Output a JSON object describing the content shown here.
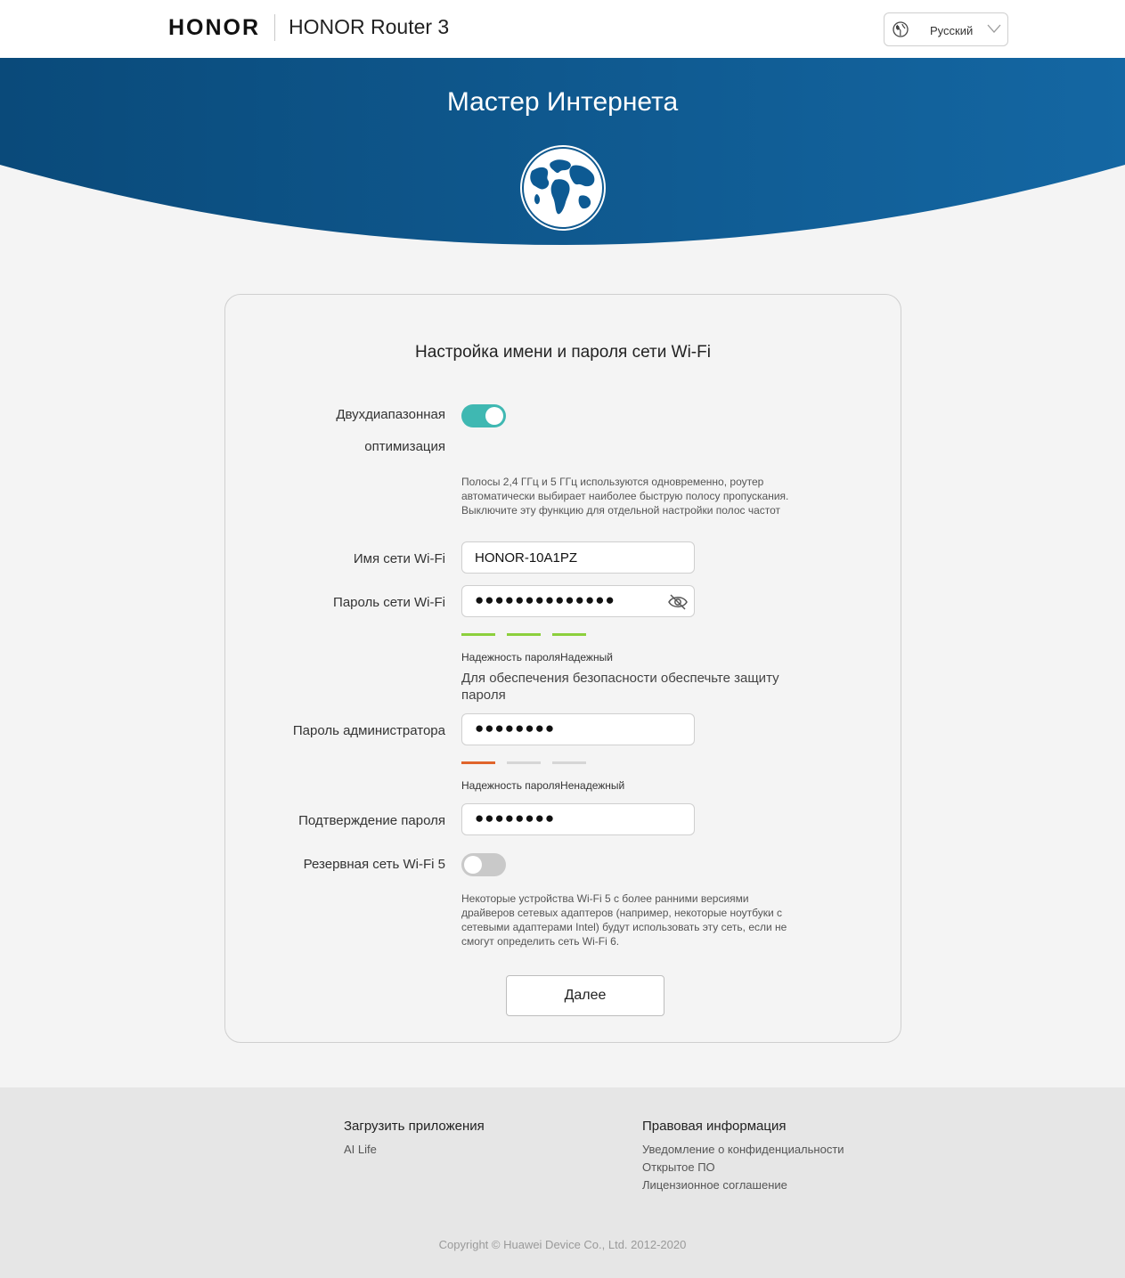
{
  "header": {
    "logo": "HONOR",
    "product": "HONOR Router 3",
    "language": "Русский"
  },
  "banner": {
    "title": "Мастер Интернета",
    "gradient_start": "#0a4a7a",
    "gradient_end": "#1467a3"
  },
  "card": {
    "title": "Настройка имени и пароля сети Wi-Fi",
    "dual_band": {
      "label_line1": "Двухдиапазонная",
      "label_line2": "оптимизация",
      "enabled": true,
      "hint": "Полосы 2,4 ГГц и 5 ГГц используются одновременно, роутер автоматически выбирает наиболее быструю полосу пропускания. Выключите эту функцию для отдельной настройки полос частот"
    },
    "wifi_name": {
      "label": "Имя сети Wi-Fi",
      "value": "HONOR-10A1PZ"
    },
    "wifi_password": {
      "label": "Пароль сети Wi-Fi",
      "value": "●●●●●●●●●●●●●●",
      "strength_text": "Надежность пароляНадежный",
      "strength_bars": 3,
      "strength_color": "#8ccf3c",
      "note": "Для обеспечения безопасности обеспечьте защиту пароля"
    },
    "admin_password": {
      "label": "Пароль администратора",
      "value": "●●●●●●●●",
      "strength_text": "Надежность пароляНенадежный",
      "strength_bars": 1,
      "strength_color": "#e0642b"
    },
    "confirm_password": {
      "label": "Подтверждение пароля",
      "value": "●●●●●●●●"
    },
    "wifi5_backup": {
      "label": "Резервная сеть Wi-Fi 5",
      "enabled": false,
      "hint": "Некоторые устройства Wi-Fi 5 с более ранними версиями драйверов сетевых адаптеров (например, некоторые ноутбуки с сетевыми адаптерами Intel) будут использовать эту сеть, если не смогут определить сеть Wi-Fi 6."
    },
    "next_button": "Далее"
  },
  "footer": {
    "apps_title": "Загрузить приложения",
    "apps_links": [
      "AI Life"
    ],
    "legal_title": "Правовая информация",
    "legal_links": [
      "Уведомление о конфиденциальности",
      "Открытое ПО",
      "Лицензионное соглашение"
    ],
    "copyright": "Copyright © Huawei Device Co., Ltd. 2012-2020"
  }
}
